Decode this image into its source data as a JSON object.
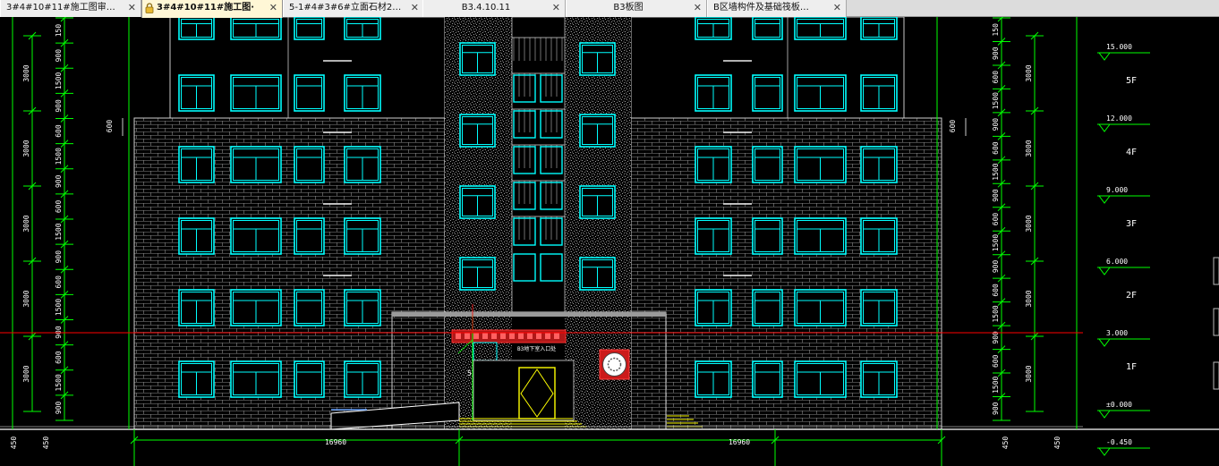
{
  "tabs": [
    {
      "label": "3#4#10#11#施工图审…",
      "active": false
    },
    {
      "label": "3#4#10#11#施工图·",
      "active": true
    },
    {
      "label": "5-1#4#3#6#立面石材2…",
      "active": false
    },
    {
      "label": "B3.4.10.11",
      "active": false
    },
    {
      "label": "B3板图",
      "active": false
    },
    {
      "label": "B区墙构件及基础筏板…",
      "active": false
    }
  ],
  "tab_close_glyph": "✕",
  "drawing": {
    "colors": {
      "background": "#000000",
      "dimension": "#00ff00",
      "window": "#00ffff",
      "wall_hatch": "#8a8a8a",
      "cursor_line": "#ff0000",
      "text": "#ffffff",
      "door": "#ffff00"
    },
    "left_dims_outer": [
      "3000",
      "3000",
      "3000",
      "3000",
      "3000"
    ],
    "left_dims_inner": [
      "150",
      "900",
      "1500",
      "900",
      "600",
      "1500",
      "900",
      "600",
      "1500",
      "900",
      "600",
      "1500",
      "900",
      "600",
      "1500",
      "900"
    ],
    "right_dims_outer": [
      "3000",
      "3000",
      "3000",
      "3000",
      "3000"
    ],
    "right_dims_inner": [
      "150",
      "900",
      "600",
      "1500",
      "900",
      "600",
      "1500",
      "900",
      "600",
      "1500",
      "900",
      "600",
      "1500",
      "900",
      "600",
      "1500",
      "900"
    ],
    "parapet_dim": "600",
    "bottom_dims": [
      "450",
      "450",
      "16960",
      "16960",
      "450",
      "450"
    ],
    "levels": [
      {
        "elevation": "15.000",
        "floor": "5F"
      },
      {
        "elevation": "12.000",
        "floor": "4F"
      },
      {
        "elevation": "9.000",
        "floor": "3F"
      },
      {
        "elevation": "6.000",
        "floor": "2F"
      },
      {
        "elevation": "3.000",
        "floor": "1F"
      },
      {
        "elevation": "±0.000",
        "floor": ""
      },
      {
        "elevation": "-0.450",
        "floor": ""
      }
    ],
    "entrance_sign": "",
    "entrance_small_text": "B3地下室入口处",
    "door_mark": "5"
  }
}
